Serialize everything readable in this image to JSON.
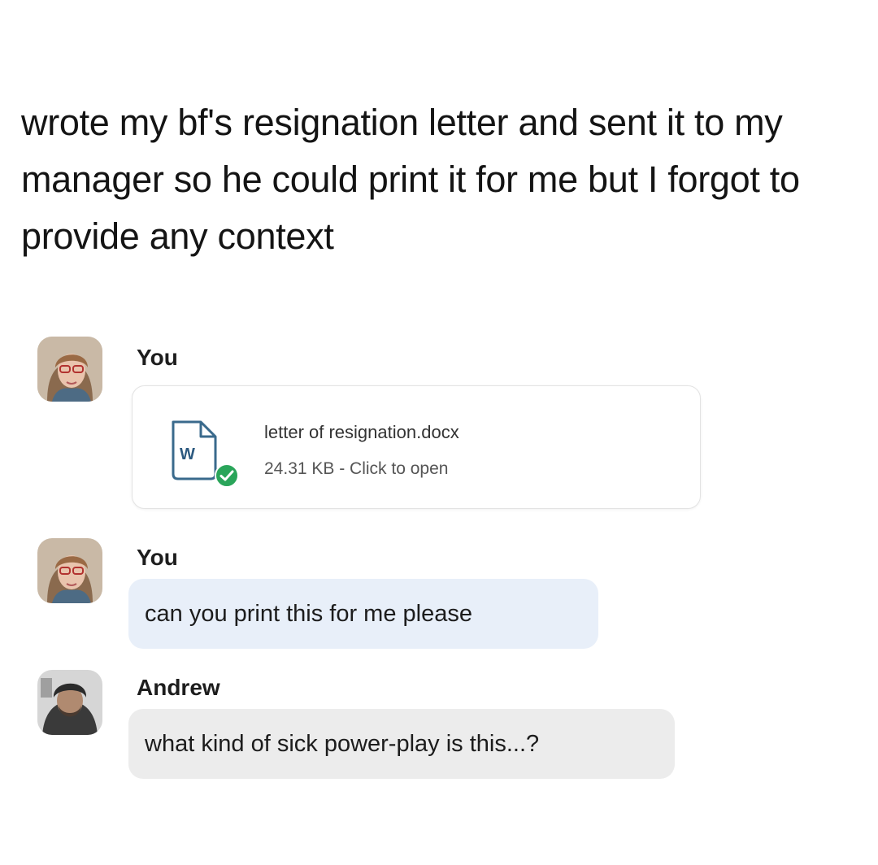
{
  "post": {
    "caption": "wrote my bf's resignation letter and sent it to my manager so he could print it for me but I forgot to provide any context"
  },
  "chat": {
    "messages": [
      {
        "sender": "You",
        "type": "file",
        "file": {
          "name": "letter of resignation.docx",
          "meta": "24.31 KB - Click to open",
          "icon": "word-document-icon",
          "status_icon": "check-circle-icon"
        }
      },
      {
        "sender": "You",
        "type": "text",
        "text": "can you print this for me please"
      },
      {
        "sender": "Andrew",
        "type": "text",
        "text": "what kind of sick power-play is this...?"
      }
    ]
  },
  "colors": {
    "my_bubble": "#e8eff9",
    "other_bubble": "#ececec",
    "check_green": "#2aa55a",
    "card_border": "#e3e3e3"
  }
}
